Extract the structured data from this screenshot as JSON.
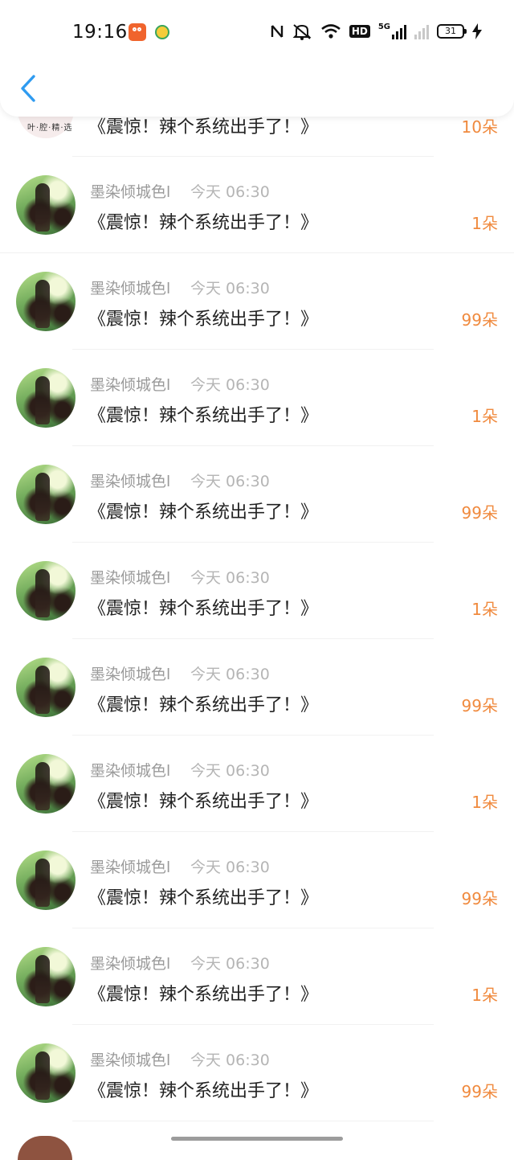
{
  "status_bar": {
    "time": "19:16",
    "network": "5G",
    "hd": "HD",
    "battery": "31"
  },
  "nav": {
    "back_icon": "chevron-left-icon"
  },
  "colors": {
    "accent": "#2f9bf0",
    "count": "#f08a3e",
    "muted": "#9a9a9a"
  },
  "partial_top_item": {
    "logo": "叶·腔·精·选",
    "title": "《震惊！辣个系统出手了！》",
    "count": "10朵"
  },
  "items": [
    {
      "name": "墨染倾城色l",
      "time": "今天 06:30",
      "title": "《震惊！辣个系统出手了！》",
      "count": "1朵"
    },
    {
      "name": "墨染倾城色l",
      "time": "今天 06:30",
      "title": "《震惊！辣个系统出手了！》",
      "count": "99朵"
    },
    {
      "name": "墨染倾城色l",
      "time": "今天 06:30",
      "title": "《震惊！辣个系统出手了！》",
      "count": "1朵"
    },
    {
      "name": "墨染倾城色l",
      "time": "今天 06:30",
      "title": "《震惊！辣个系统出手了！》",
      "count": "99朵"
    },
    {
      "name": "墨染倾城色l",
      "time": "今天 06:30",
      "title": "《震惊！辣个系统出手了！》",
      "count": "1朵"
    },
    {
      "name": "墨染倾城色l",
      "time": "今天 06:30",
      "title": "《震惊！辣个系统出手了！》",
      "count": "99朵"
    },
    {
      "name": "墨染倾城色l",
      "time": "今天 06:30",
      "title": "《震惊！辣个系统出手了！》",
      "count": "1朵"
    },
    {
      "name": "墨染倾城色l",
      "time": "今天 06:30",
      "title": "《震惊！辣个系统出手了！》",
      "count": "99朵"
    },
    {
      "name": "墨染倾城色l",
      "time": "今天 06:30",
      "title": "《震惊！辣个系统出手了！》",
      "count": "1朵"
    },
    {
      "name": "墨染倾城色l",
      "time": "今天 06:30",
      "title": "《震惊！辣个系统出手了！》",
      "count": "99朵"
    }
  ]
}
